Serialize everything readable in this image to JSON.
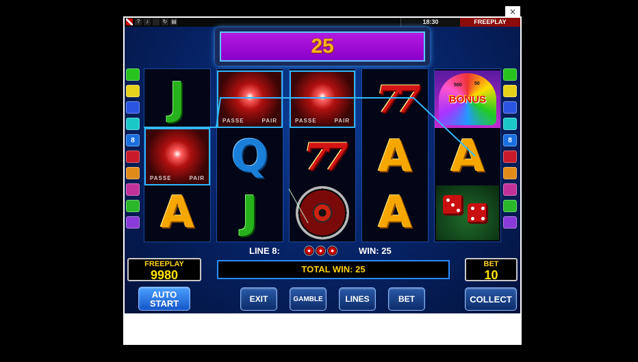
{
  "window": {
    "close_glyph": "×"
  },
  "topbar": {
    "icons": [
      "flag-icon",
      "help-icon",
      "sound-icon",
      "fullscreen-icon",
      "reload-icon",
      "history-icon"
    ],
    "help_glyph": "?",
    "sound_glyph": "♪",
    "reload_glyph": "↻",
    "history_glyph": "▤",
    "clock": "18:30",
    "mode": "FREEPLAY"
  },
  "win_display": {
    "value": "25"
  },
  "reels": {
    "symbols": [
      [
        "J",
        "roulette",
        "A"
      ],
      [
        "roulette",
        "Q",
        "J"
      ],
      [
        "roulette",
        "7",
        "wheel"
      ],
      [
        "7",
        "A",
        "A"
      ],
      [
        "bonus",
        "A",
        "dice"
      ]
    ],
    "roulette_labels": {
      "left": "PASSE",
      "right": "PAIR"
    },
    "bonus_label": "BONUS",
    "bonus_numbers": [
      "500",
      "50"
    ],
    "seven_text": "77"
  },
  "side_lines": {
    "left_highlight": "8",
    "right_highlight": "8",
    "colors": [
      "#27c21d",
      "#e6d21a",
      "#2a55e0",
      "#1ac8c8",
      "#1a6fe0",
      "#c81a2a",
      "#e08a1a",
      "#c2309a",
      "#2ab82a",
      "#8a3ad8"
    ]
  },
  "info": {
    "line_label": "LINE 8:",
    "win_label": "WIN: 25"
  },
  "freeplay_panel": {
    "label": "FREEPLAY",
    "value": "9980"
  },
  "bet_panel": {
    "label": "BET",
    "value": "10"
  },
  "total_win": "TOTAL WIN: 25",
  "buttons": {
    "auto_line1": "AUTO",
    "auto_line2": "START",
    "exit": "EXIT",
    "gamble": "GAMBLE",
    "lines": "LINES",
    "bet": "BET",
    "collect": "COLLECT"
  }
}
